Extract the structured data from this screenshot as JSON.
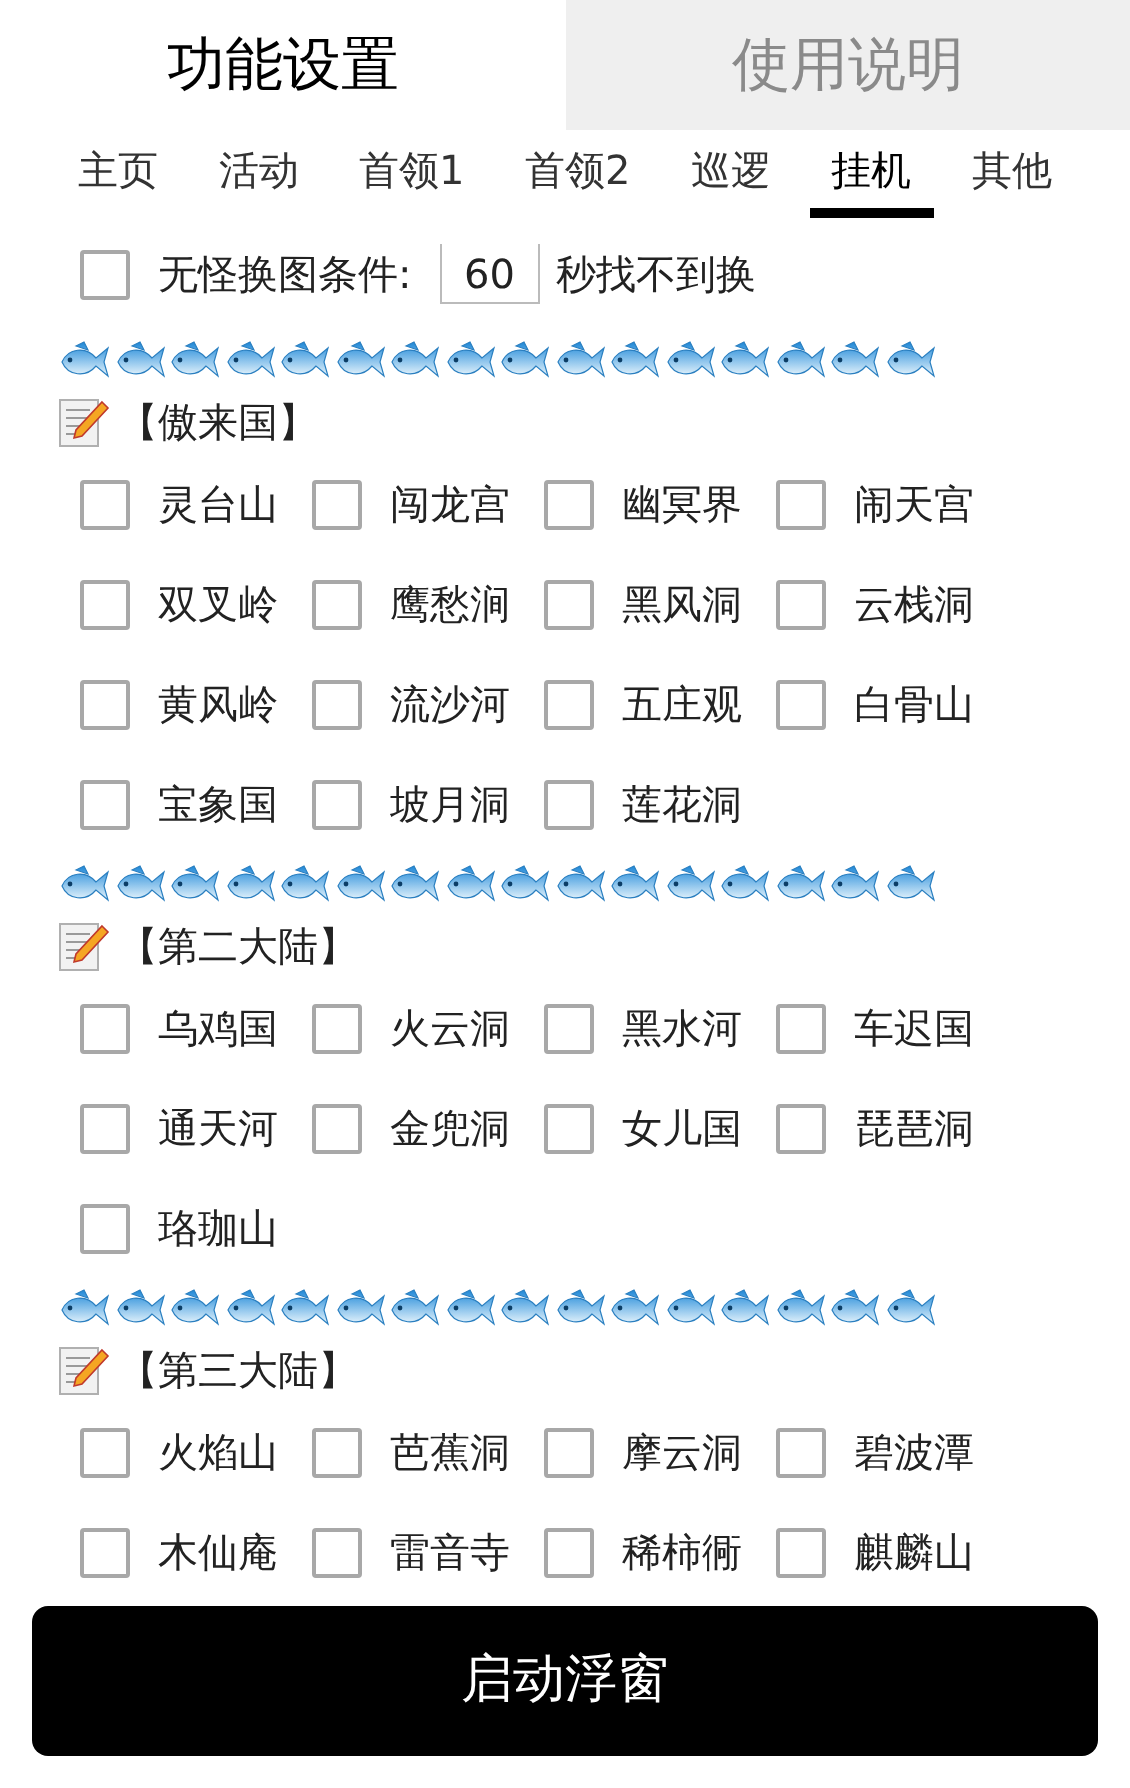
{
  "top_tabs": [
    {
      "label": "功能设置",
      "selected": true
    },
    {
      "label": "使用说明",
      "selected": false
    }
  ],
  "sub_tabs": [
    {
      "label": "主页",
      "selected": false
    },
    {
      "label": "活动",
      "selected": false
    },
    {
      "label": "首领1",
      "selected": false
    },
    {
      "label": "首领2",
      "selected": false
    },
    {
      "label": "巡逻",
      "selected": false
    },
    {
      "label": "挂机",
      "selected": true
    },
    {
      "label": "其他",
      "selected": false
    }
  ],
  "option": {
    "checked": false,
    "label": "无怪换图条件:",
    "value": "60",
    "suffix": "秒找不到换"
  },
  "sections": [
    {
      "title": "【傲来国】",
      "places": [
        {
          "label": "灵台山",
          "checked": false
        },
        {
          "label": "闯龙宫",
          "checked": false
        },
        {
          "label": "幽冥界",
          "checked": false
        },
        {
          "label": "闹天宫",
          "checked": false
        },
        {
          "label": "双叉岭",
          "checked": false
        },
        {
          "label": "鹰愁涧",
          "checked": false
        },
        {
          "label": "黑风洞",
          "checked": false
        },
        {
          "label": "云栈洞",
          "checked": false
        },
        {
          "label": "黄风岭",
          "checked": false
        },
        {
          "label": "流沙河",
          "checked": false
        },
        {
          "label": "五庄观",
          "checked": false
        },
        {
          "label": "白骨山",
          "checked": false
        },
        {
          "label": "宝象国",
          "checked": false
        },
        {
          "label": "坡月洞",
          "checked": false
        },
        {
          "label": "莲花洞",
          "checked": false
        }
      ]
    },
    {
      "title": "【第二大陆】",
      "places": [
        {
          "label": "乌鸡国",
          "checked": false
        },
        {
          "label": "火云洞",
          "checked": false
        },
        {
          "label": "黑水河",
          "checked": false
        },
        {
          "label": "车迟国",
          "checked": false
        },
        {
          "label": "通天河",
          "checked": false
        },
        {
          "label": "金兜洞",
          "checked": false
        },
        {
          "label": "女儿国",
          "checked": false
        },
        {
          "label": "琵琶洞",
          "checked": false
        },
        {
          "label": "珞珈山",
          "checked": false
        }
      ]
    },
    {
      "title": "【第三大陆】",
      "places": [
        {
          "label": "火焰山",
          "checked": false
        },
        {
          "label": "芭蕉洞",
          "checked": false
        },
        {
          "label": "摩云洞",
          "checked": false
        },
        {
          "label": "碧波潭",
          "checked": false
        },
        {
          "label": "木仙庵",
          "checked": false
        },
        {
          "label": "雷音寺",
          "checked": false
        },
        {
          "label": "稀柿衕",
          "checked": false
        },
        {
          "label": "麒麟山",
          "checked": false
        }
      ]
    }
  ],
  "start_button": "启动浮窗"
}
